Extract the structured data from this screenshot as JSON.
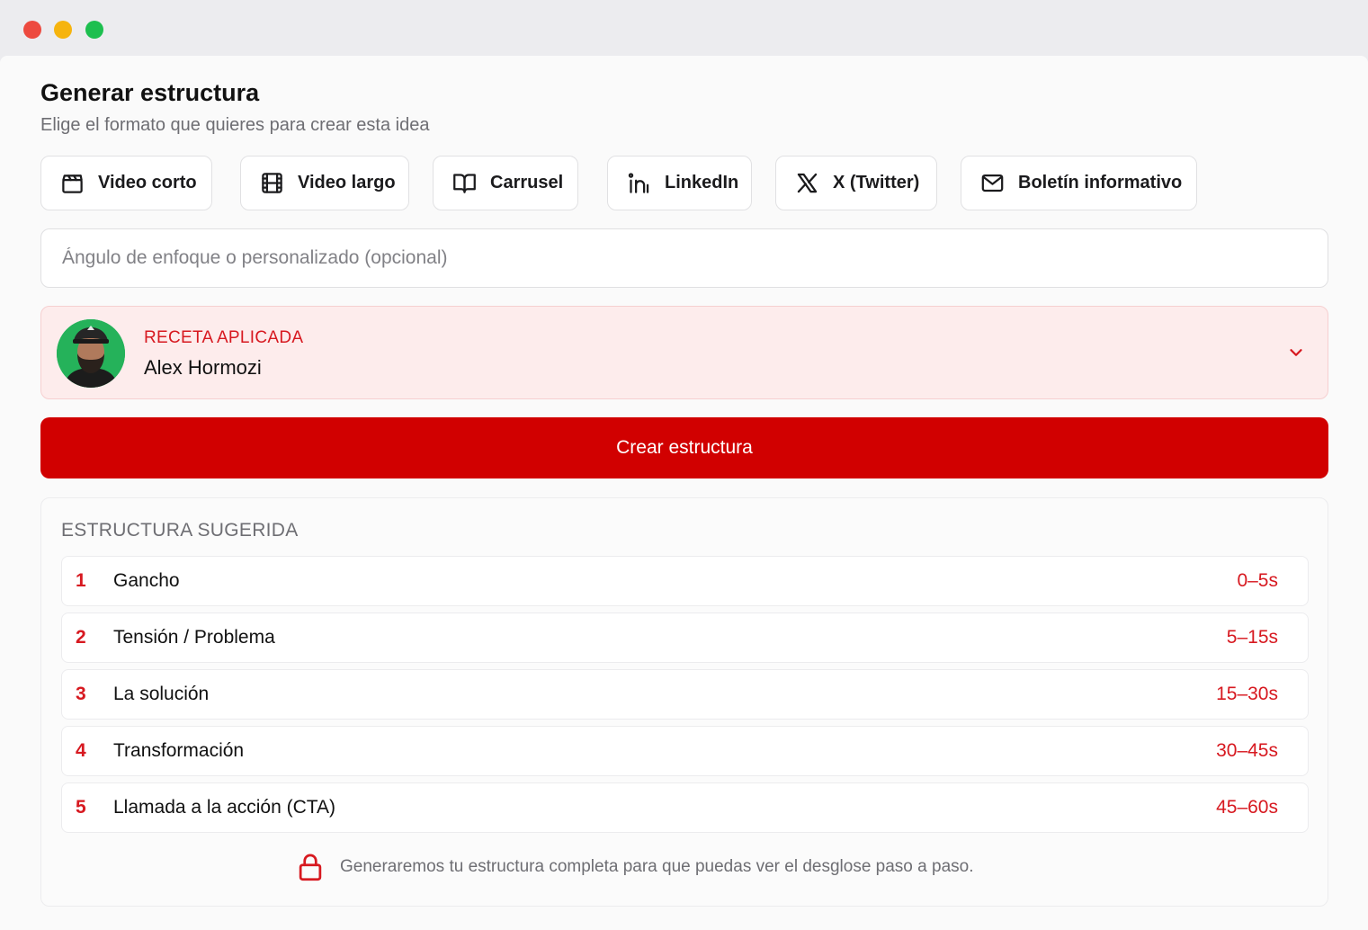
{
  "window": {
    "controls": [
      "close",
      "minimize",
      "maximize"
    ]
  },
  "header": {
    "title": "Generar estructura",
    "subtitle": "Elige el formato que quieres para crear esta idea"
  },
  "formats": [
    {
      "label": "Video corto",
      "icon": "clapperboard-icon"
    },
    {
      "label": "Video largo",
      "icon": "film-icon"
    },
    {
      "label": "Carrusel",
      "icon": "book-open-icon"
    },
    {
      "label": "LinkedIn",
      "icon": "linkedin-icon"
    },
    {
      "label": "X (Twitter)",
      "icon": "x-logo-icon"
    },
    {
      "label": "Boletín informativo",
      "icon": "mail-icon"
    }
  ],
  "angle_input": {
    "placeholder": "Ángulo de enfoque o personalizado (opcional)",
    "value": ""
  },
  "recipe": {
    "label": "RECETA APLICADA",
    "name": "Alex Hormozi",
    "avatar_icon": "avatar-photo",
    "dropdown_icon": "chevron-down-icon"
  },
  "create_button": {
    "label": "Crear estructura"
  },
  "suggested": {
    "title": "ESTRUCTURA SUGERIDA",
    "steps": [
      {
        "num": "1",
        "label": "Gancho",
        "duration": "0–5s"
      },
      {
        "num": "2",
        "label": "Tensión / Problema",
        "duration": "5–15s"
      },
      {
        "num": "3",
        "label": "La solución",
        "duration": "15–30s"
      },
      {
        "num": "4",
        "label": "Transformación",
        "duration": "30–45s"
      },
      {
        "num": "5",
        "label": "Llamada a la acción (CTA)",
        "duration": "45–60s"
      }
    ],
    "note": "Generaremos tu estructura completa para que puedas ver el desglose paso a paso.",
    "note_icon": "lock-icon"
  },
  "colors": {
    "accent": "#d10000",
    "accent_text": "#d71920",
    "recipe_bg": "#fdecec",
    "muted_text": "#6e6e73"
  }
}
